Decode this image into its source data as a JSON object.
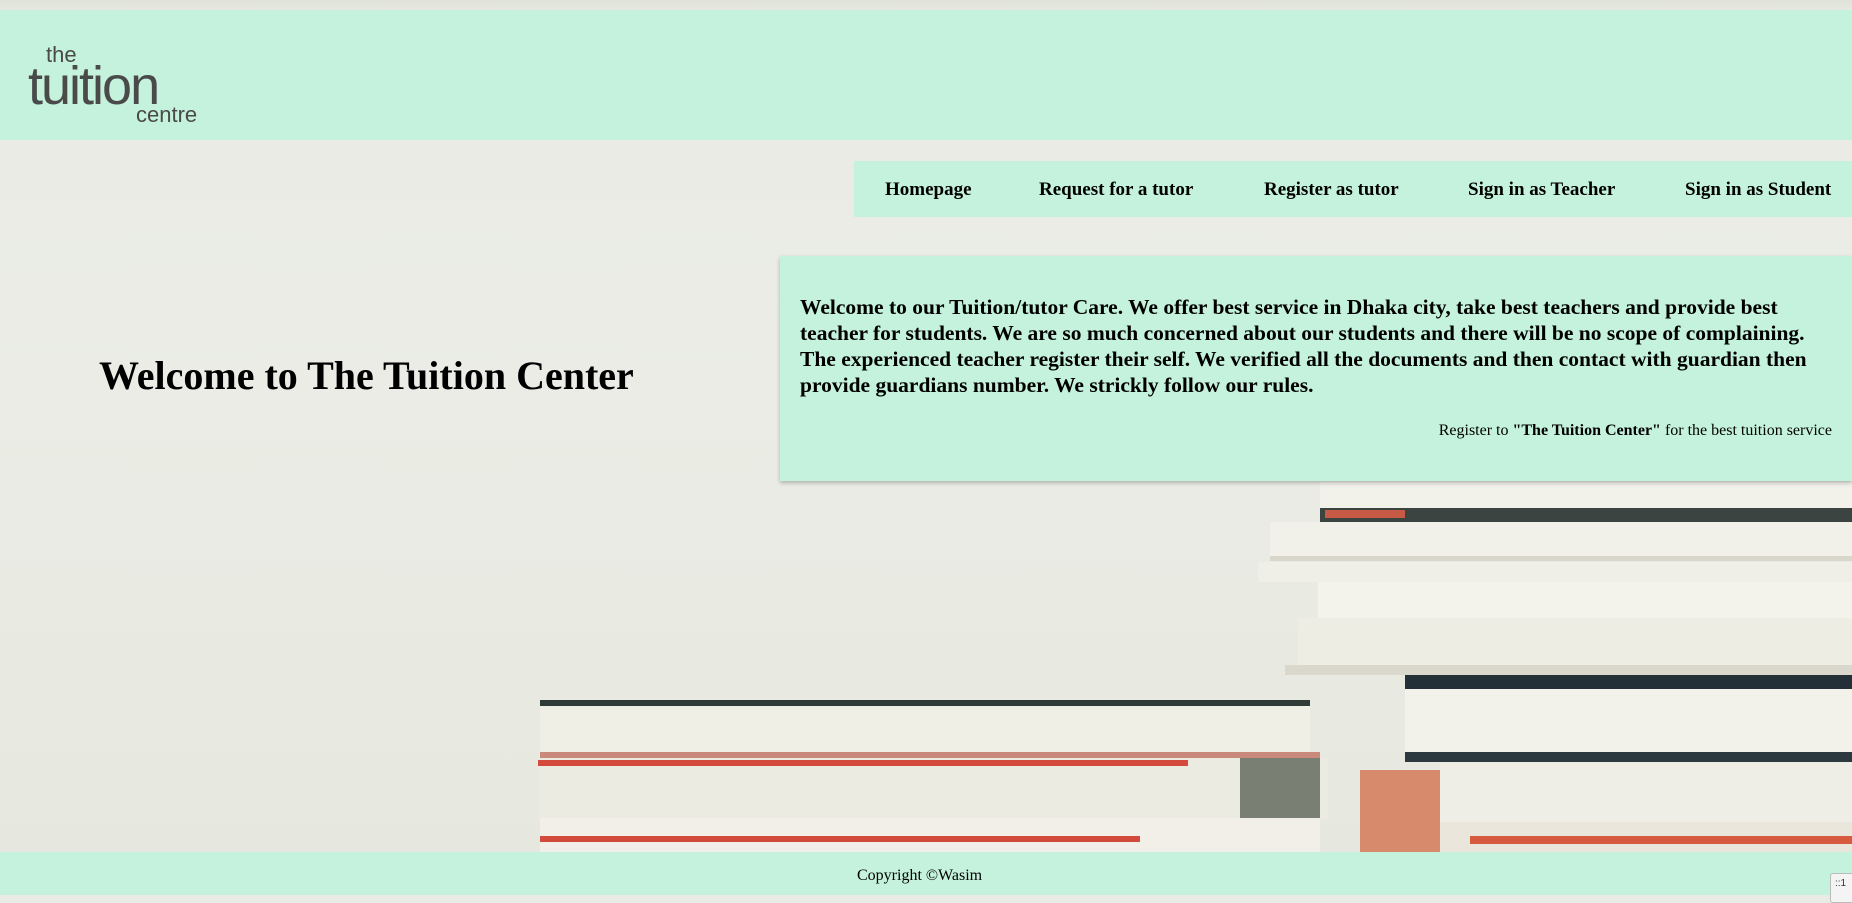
{
  "brand": {
    "logo_line1": "the",
    "logo_line2": "tuition",
    "logo_line3": "centre",
    "colors": {
      "mint": "#c4f2dc",
      "logo_gray": "#4a4a4a"
    }
  },
  "nav": {
    "items": [
      {
        "label": "Homepage"
      },
      {
        "label": "Request for a tutor"
      },
      {
        "label": "Register as tutor"
      },
      {
        "label": "Sign in as Teacher"
      },
      {
        "label": "Sign in as Student"
      }
    ]
  },
  "hero": {
    "title": "Welcome to The Tuition Center"
  },
  "info": {
    "text": "Welcome to our Tuition/tutor Care. We offer best service in Dhaka city, take best teachers and provide best teacher for students. We are so much concerned about our students and there will be no scope of complaining. The experienced teacher register their self. We verified all the documents and then contact with guardian then provide guardians number. We strickly follow our rules.",
    "cta_prefix": "Register to ",
    "cta_brand": "\"The Tuition Center\"",
    "cta_suffix": " for the best tuition service"
  },
  "footer": {
    "copyright": "Copyright ©Wasim"
  },
  "corner": {
    "label": "::1"
  }
}
